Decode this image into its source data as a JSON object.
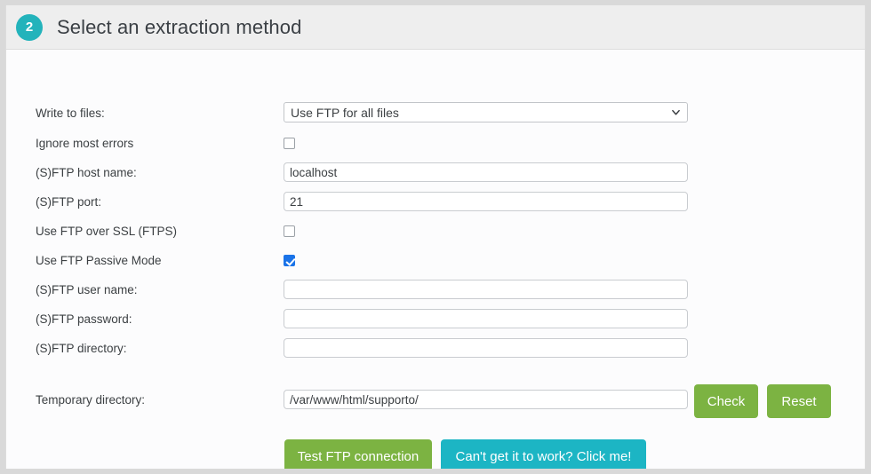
{
  "header": {
    "step_number": "2",
    "title": "Select an extraction method",
    "badge_color": "#23b3bb",
    "background": "#eeeeee"
  },
  "form": {
    "rows": [
      {
        "label": "Write to files:",
        "type": "select",
        "value": "Use FTP for all files"
      },
      {
        "label": "Ignore most errors",
        "type": "checkbox",
        "checked": false
      },
      {
        "label": "(S)FTP host name:",
        "type": "text",
        "value": "localhost",
        "placeholder": ""
      },
      {
        "label": "(S)FTP port:",
        "type": "text",
        "value": "21",
        "placeholder": ""
      },
      {
        "label": "Use FTP over SSL (FTPS)",
        "type": "checkbox",
        "checked": false
      },
      {
        "label": "Use FTP Passive Mode",
        "type": "checkbox",
        "checked": true
      },
      {
        "label": "(S)FTP user name:",
        "type": "text",
        "value": "",
        "placeholder": ""
      },
      {
        "label": "(S)FTP password:",
        "type": "text",
        "value": "",
        "placeholder": ""
      },
      {
        "label": "(S)FTP directory:",
        "type": "text",
        "value": "",
        "placeholder": ""
      },
      {
        "label": "Temporary directory:",
        "type": "text",
        "value": "/var/www/html/supporto/",
        "placeholder": ""
      }
    ],
    "select_options": [
      "Use FTP for all files"
    ]
  },
  "buttons": {
    "check": "Check",
    "reset": "Reset",
    "test_connection": "Test FTP connection",
    "help": "Can't get it to work? Click me!",
    "green_color": "#7cb342",
    "teal_color": "#1cb5c4"
  },
  "icons": {
    "chevron_down": "chevron-down-icon",
    "check_mark": "check-icon"
  }
}
